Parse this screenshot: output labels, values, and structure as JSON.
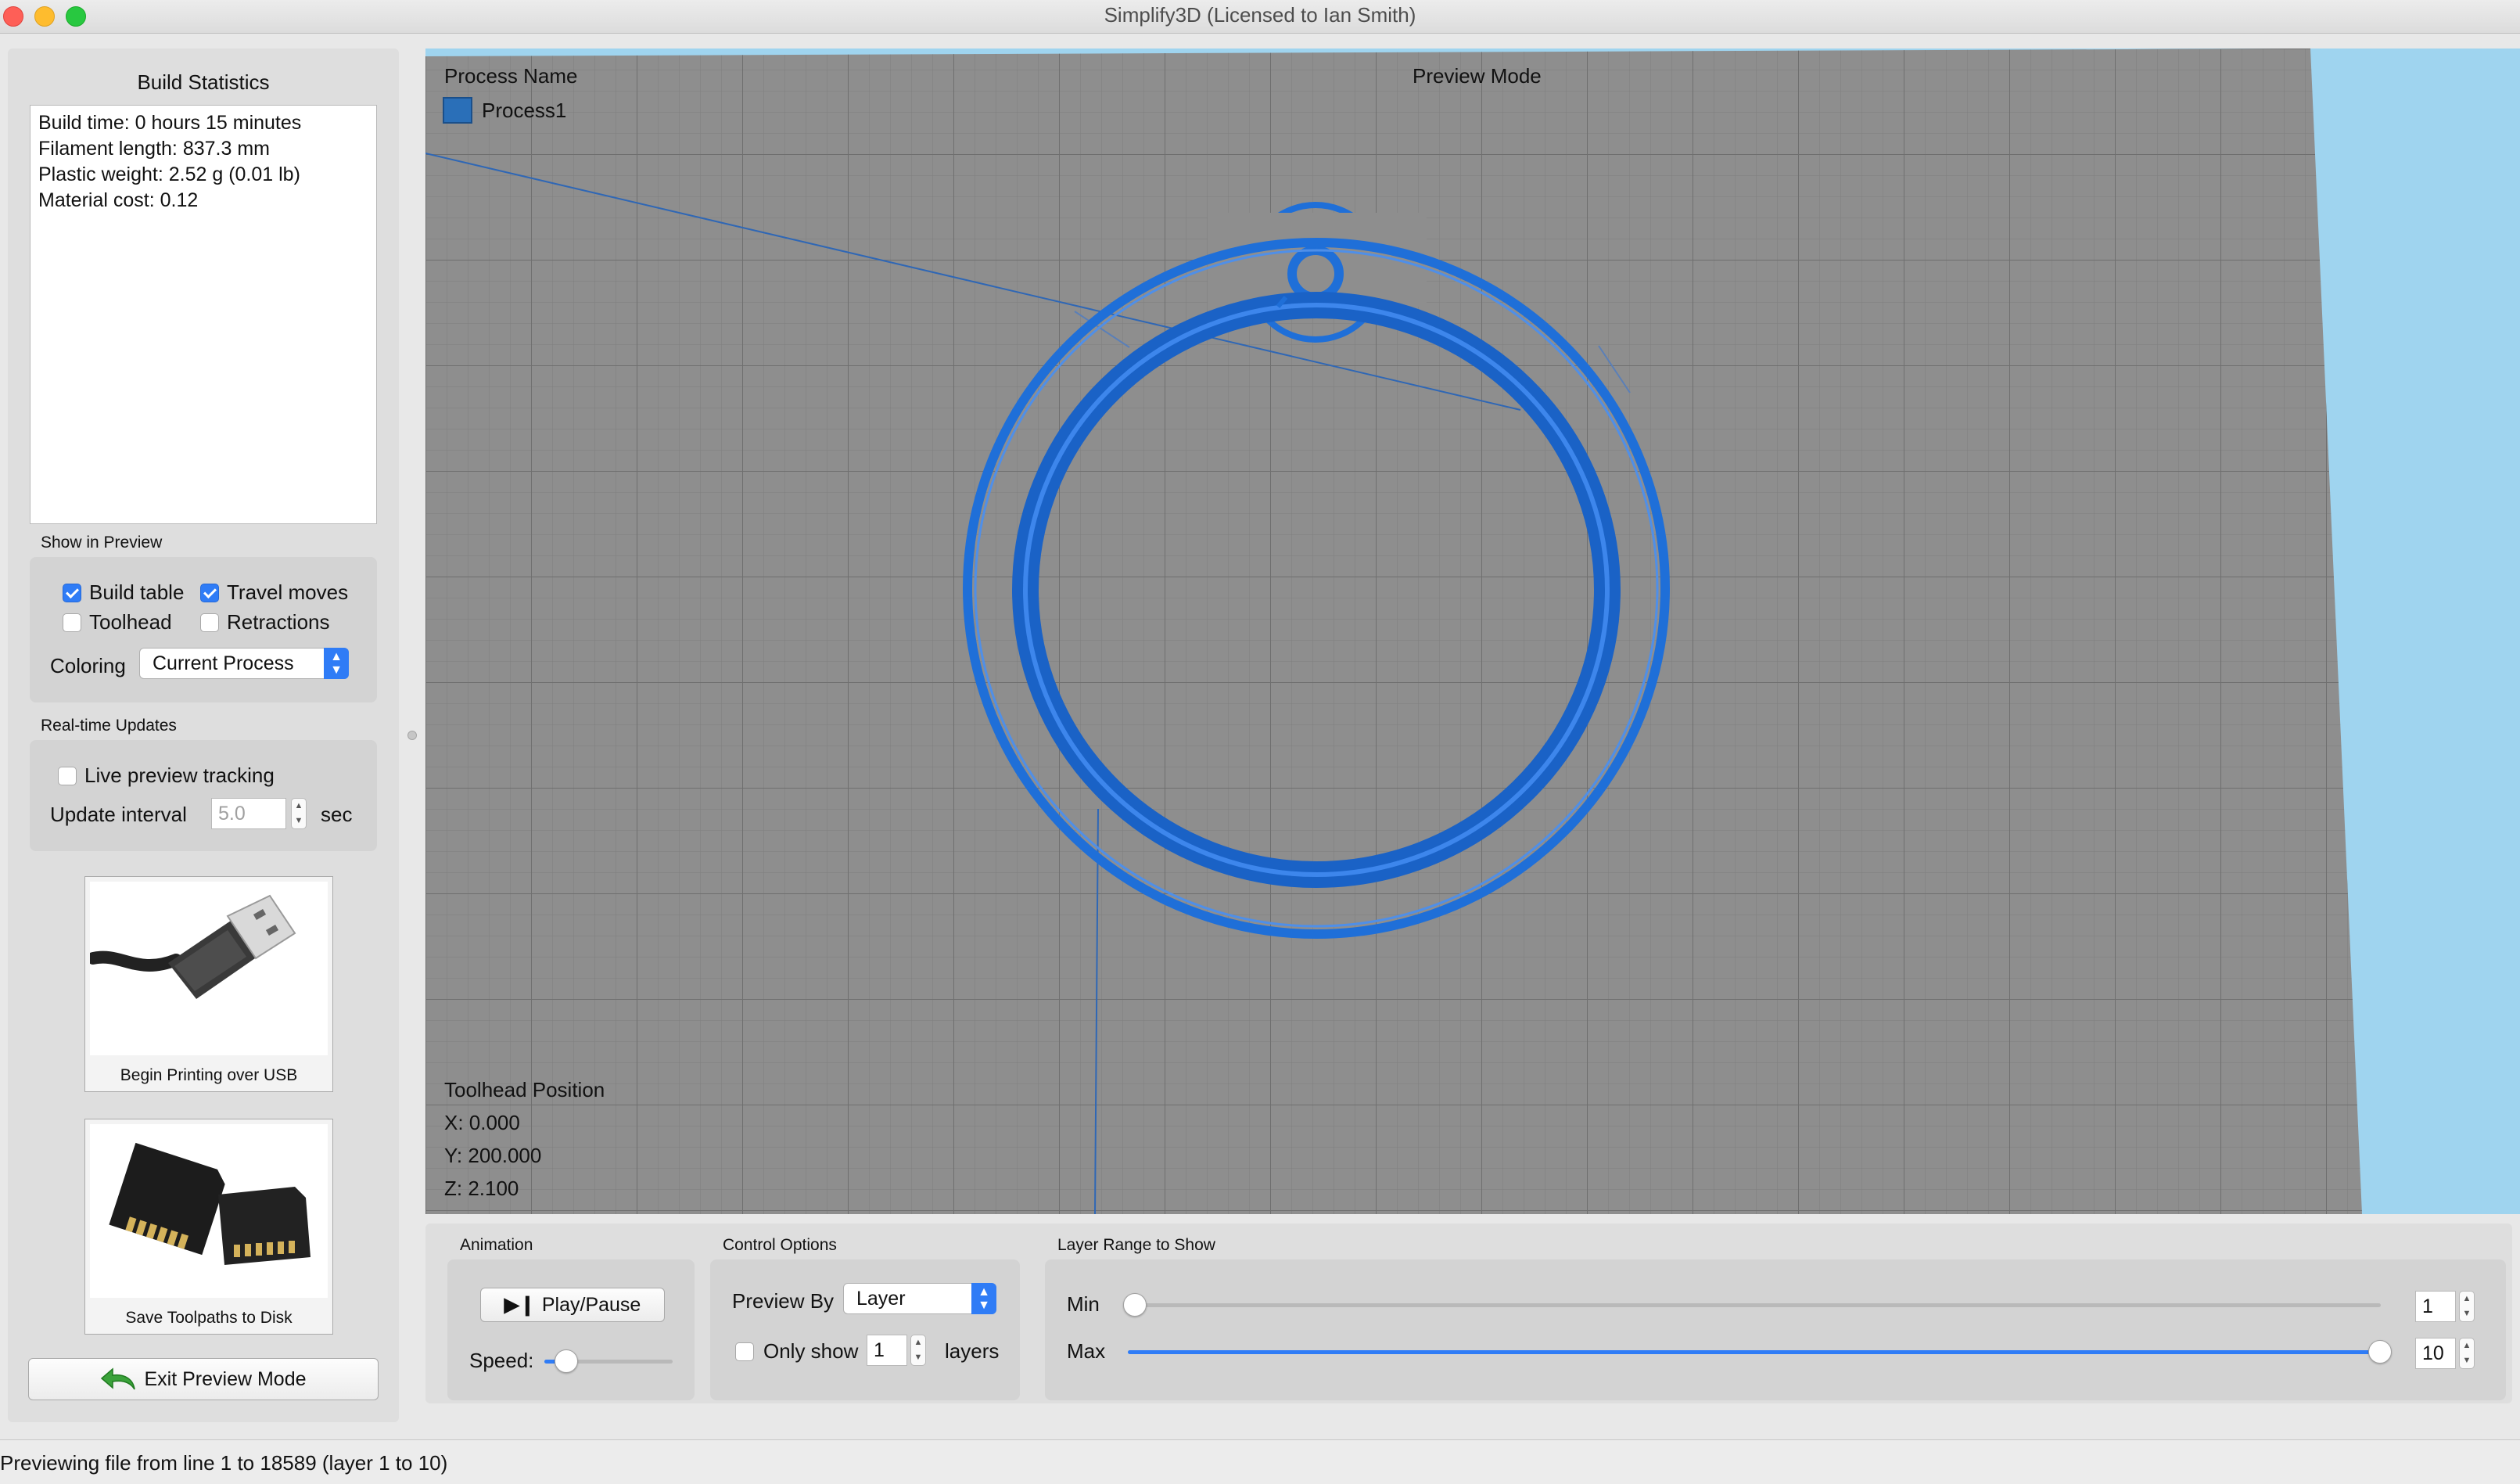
{
  "window": {
    "title": "Simplify3D (Licensed to Ian Smith)"
  },
  "build_statistics": {
    "title": "Build Statistics",
    "lines": [
      "Build time: 0 hours 15 minutes",
      "Filament length: 837.3 mm",
      "Plastic weight: 2.52 g (0.01 lb)",
      "Material cost: 0.12"
    ]
  },
  "show_in_preview": {
    "title": "Show in Preview",
    "build_table": {
      "label": "Build table",
      "checked": true
    },
    "travel_moves": {
      "label": "Travel moves",
      "checked": true
    },
    "toolhead": {
      "label": "Toolhead",
      "checked": false
    },
    "retractions": {
      "label": "Retractions",
      "checked": false
    },
    "coloring_label": "Coloring",
    "coloring_value": "Current Process"
  },
  "realtime": {
    "title": "Real-time Updates",
    "live_tracking": {
      "label": "Live preview tracking",
      "checked": false
    },
    "interval_label": "Update interval",
    "interval_value": "5.0",
    "interval_unit": "sec"
  },
  "usb_button": {
    "caption": "Begin Printing over USB"
  },
  "disk_button": {
    "caption": "Save Toolpaths to Disk"
  },
  "exit_button": {
    "label": "Exit Preview Mode"
  },
  "viewport": {
    "process_header": "Process Name",
    "mode_label": "Preview Mode",
    "process_name": "Process1",
    "process_color": "#2a6fb8",
    "toolhead_title": "Toolhead Position",
    "x": "X: 0.000",
    "y": "Y: 200.000",
    "z": "Z: 2.100",
    "model_color": "#1f6fd8"
  },
  "animation": {
    "title": "Animation",
    "play_label": "Play/Pause",
    "speed_label": "Speed:",
    "speed_value": 0.1
  },
  "control_options": {
    "title": "Control Options",
    "preview_by_label": "Preview By",
    "preview_by_value": "Layer",
    "only_show": {
      "label": "Only show",
      "checked": false
    },
    "only_show_value": "1",
    "layers_label": "layers"
  },
  "layer_range": {
    "title": "Layer Range to Show",
    "min_label": "Min",
    "min_value": "1",
    "max_label": "Max",
    "max_value": "10"
  },
  "status": {
    "text": "Previewing file from line 1 to 18589 (layer 1 to 10)"
  }
}
